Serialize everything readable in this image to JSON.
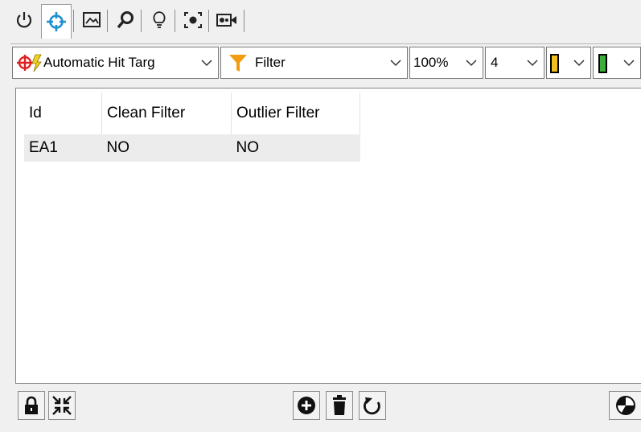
{
  "tabs": [
    {
      "name": "power-icon",
      "active": false
    },
    {
      "name": "crosshair-icon",
      "active": true
    },
    {
      "name": "image-icon",
      "active": false
    },
    {
      "name": "zoom-icon",
      "active": false
    },
    {
      "name": "lightbulb-icon",
      "active": false
    },
    {
      "name": "focus-icon",
      "active": false
    },
    {
      "name": "video-camera-icon",
      "active": false
    }
  ],
  "toolbar": {
    "target_mode": "Automatic Hit Targ",
    "filter": "Filter",
    "zoom": "100%",
    "count": "4",
    "color_1": "#f0c020",
    "color_2": "#3cae3c"
  },
  "table": {
    "columns": [
      "Id",
      "Clean Filter",
      "Outlier Filter"
    ],
    "rows": [
      [
        "EA1",
        "NO",
        "NO"
      ]
    ]
  },
  "bottombar": {
    "left_icons": [
      "lock-icon",
      "collapse-icon"
    ],
    "center_icons": [
      "add-icon",
      "delete-icon",
      "refresh-icon"
    ],
    "right_icons": [
      "pie-icon"
    ]
  },
  "colors": {
    "accent_blue": "#1e90d0",
    "target_red": "#e02020",
    "filter_orange": "#f39c12"
  }
}
